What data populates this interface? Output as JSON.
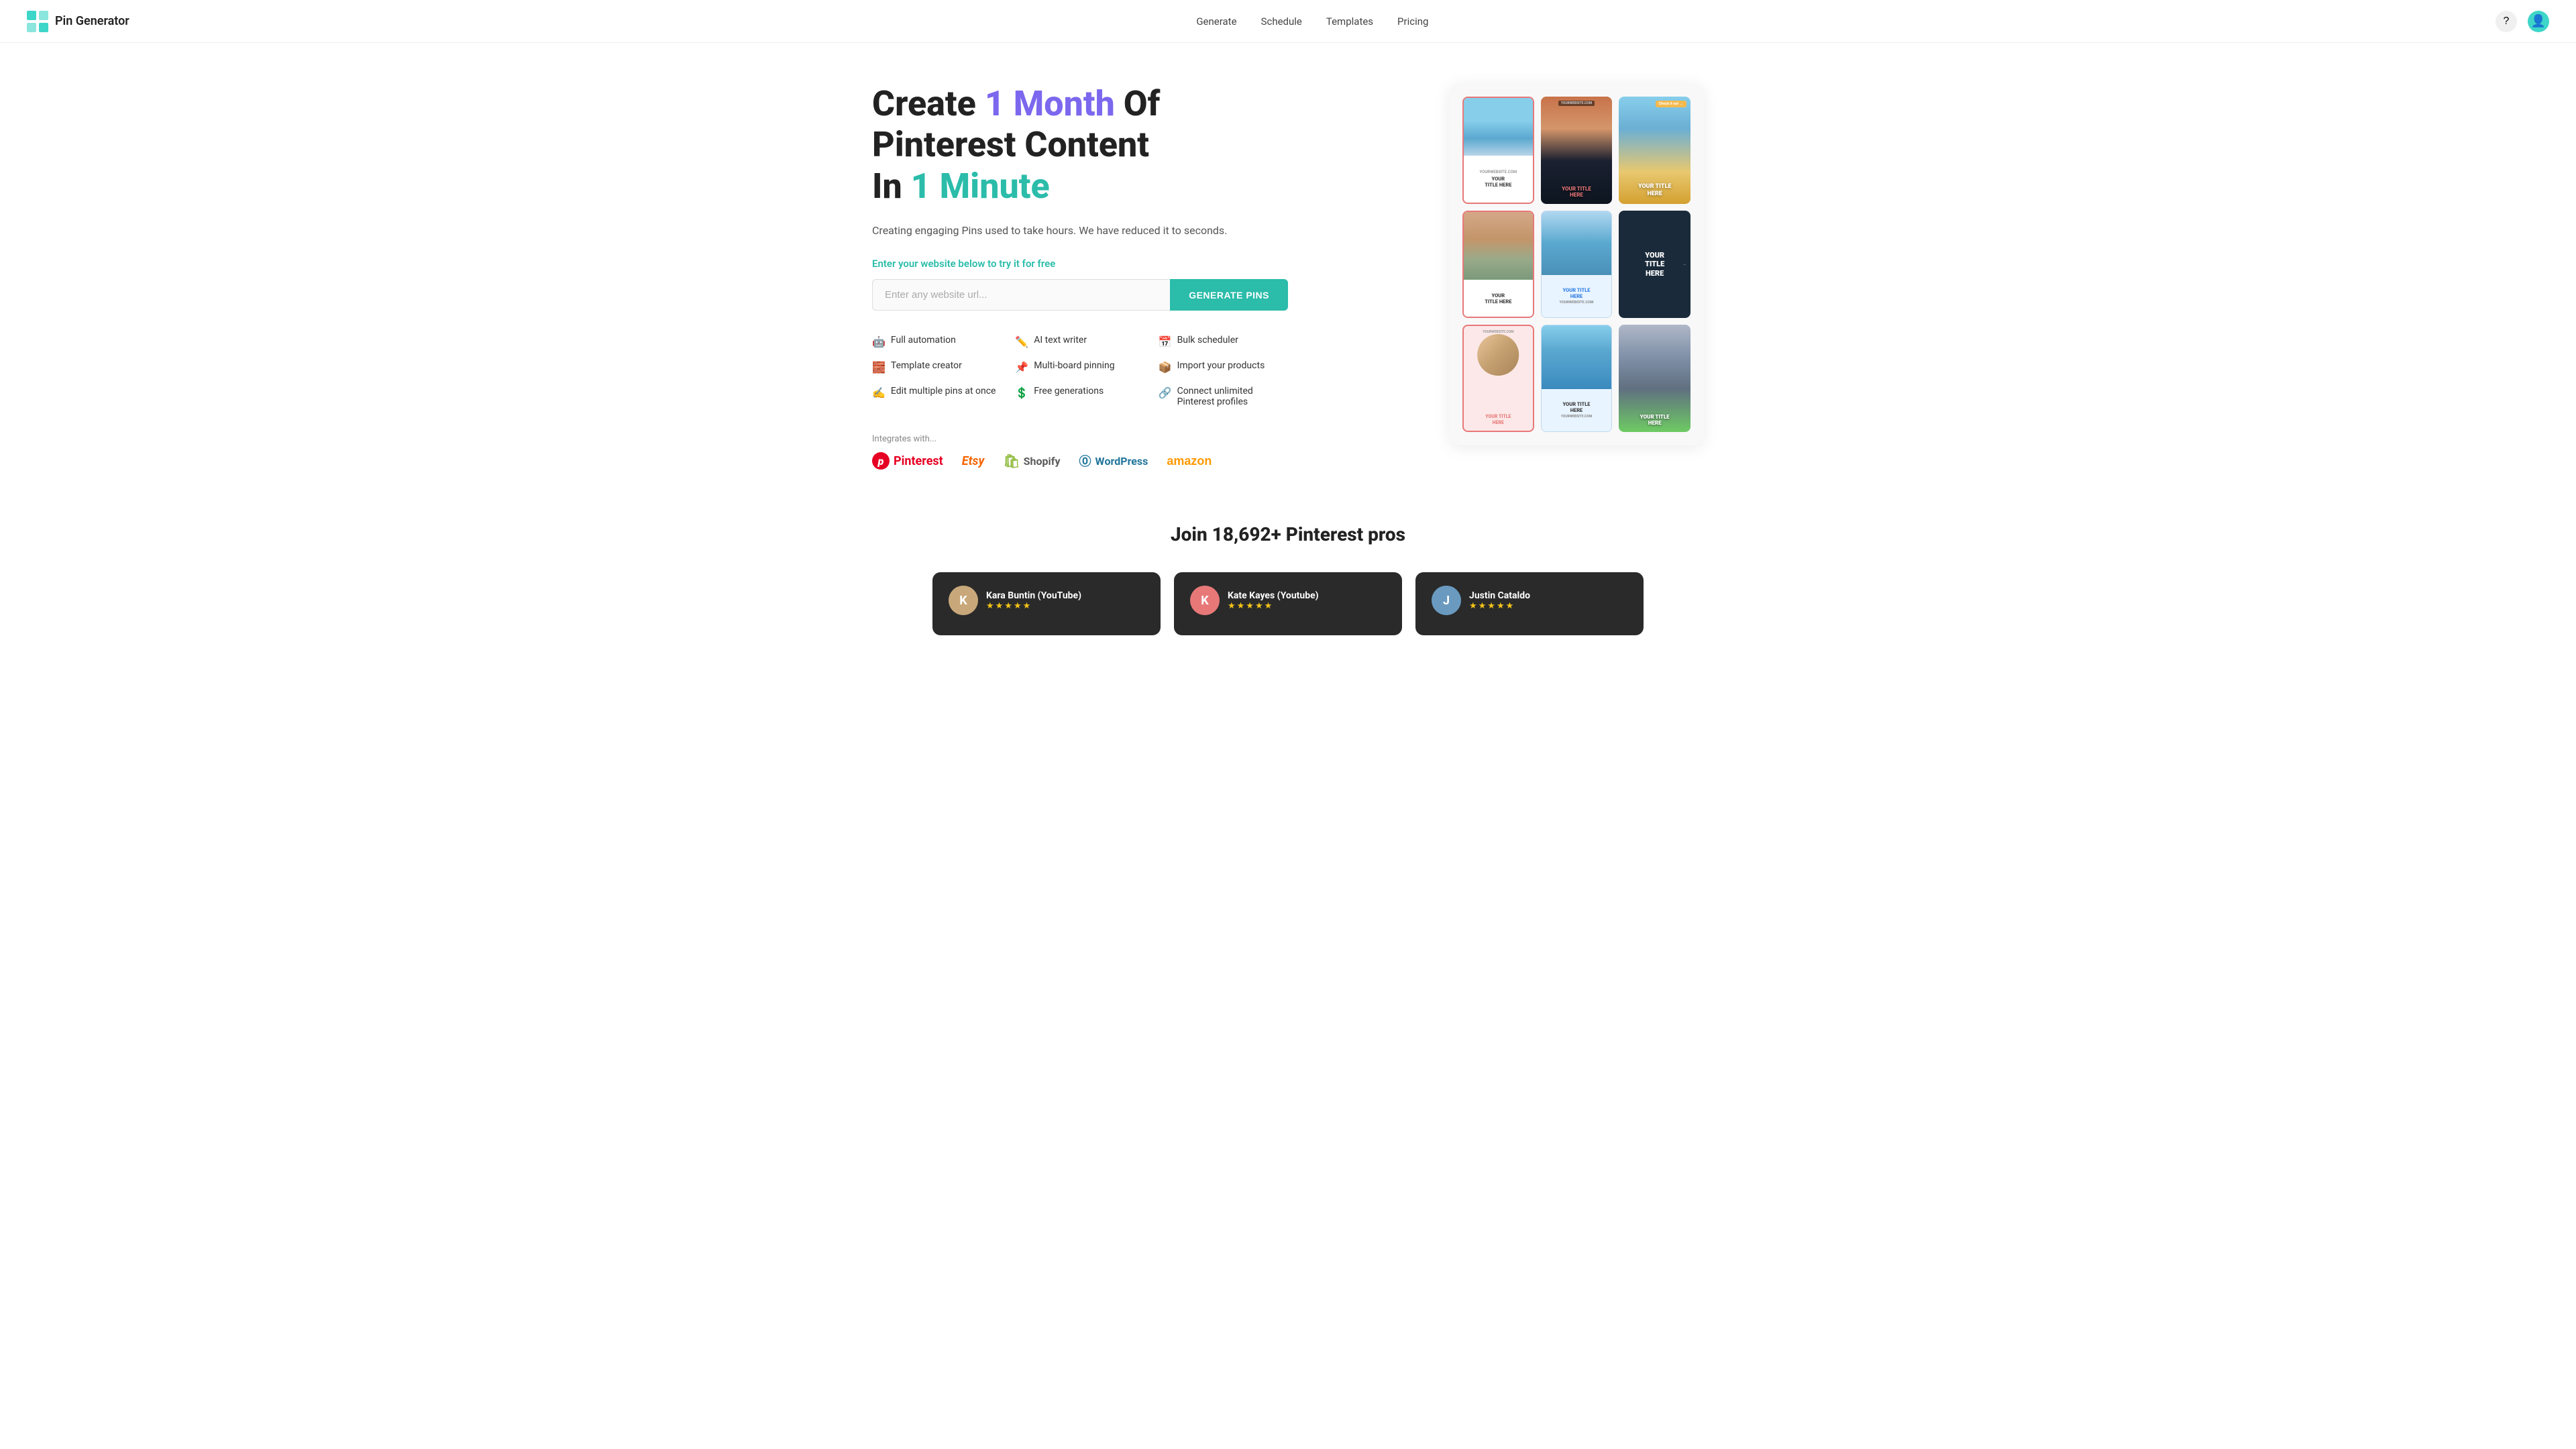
{
  "nav": {
    "logo_text": "Pin Generator",
    "links": [
      {
        "label": "Generate",
        "id": "generate"
      },
      {
        "label": "Schedule",
        "id": "schedule"
      },
      {
        "label": "Templates",
        "id": "templates"
      },
      {
        "label": "Pricing",
        "id": "pricing"
      }
    ]
  },
  "hero": {
    "title_part1": "Create ",
    "title_accent1": "1 Month",
    "title_part2": " Of",
    "title_line2": "Pinterest Content",
    "title_line3_pre": "In ",
    "title_accent2": "1 Minute",
    "subtitle": "Creating engaging Pins used to take hours. We have reduced it to seconds.",
    "cta_label": "Enter your website below to try it for free",
    "input_placeholder": "Enter any website url...",
    "button_label": "GENERATE PINS",
    "features": [
      {
        "icon": "🤖",
        "label": "Full automation"
      },
      {
        "icon": "✏️",
        "label": "AI text writer"
      },
      {
        "icon": "📅",
        "label": "Bulk scheduler"
      },
      {
        "icon": "🧱",
        "label": "Template creator"
      },
      {
        "icon": "📌",
        "label": "Multi-board pinning"
      },
      {
        "icon": "📦",
        "label": "Import your products"
      },
      {
        "icon": "✍️",
        "label": "Edit multiple pins at once"
      },
      {
        "icon": "💲",
        "label": "Free generations"
      },
      {
        "icon": "🔗",
        "label": "Connect unlimited Pinterest profiles"
      }
    ],
    "integrations_label": "Integrates with...",
    "integrations": [
      {
        "id": "pinterest",
        "label": "Pinterest"
      },
      {
        "id": "etsy",
        "label": "Etsy"
      },
      {
        "id": "shopify",
        "label": "Shopify"
      },
      {
        "id": "wordpress",
        "label": "WordPress"
      },
      {
        "id": "amazon",
        "label": "amazon"
      }
    ]
  },
  "pin_grid": {
    "cards": [
      {
        "id": "pin-1",
        "label": "YOUR\nTITLE HERE",
        "website": "YOURWEBSITE.COM",
        "bg": "white-border"
      },
      {
        "id": "pin-2",
        "label": "YOUR TITLE HERE",
        "website": "YOURWEBSITE.COM",
        "bg": "dark-photo"
      },
      {
        "id": "pin-3",
        "label": "YOUR TITLE\nHERE",
        "website": "Check it out →",
        "bg": "yellow"
      },
      {
        "id": "pin-4",
        "label": "YOUR\nTITLE HERE",
        "website": "",
        "bg": "pink-border"
      },
      {
        "id": "pin-5",
        "label": "YOUR TITLE\nHERE",
        "website": "YOURWEBSITE.COM",
        "bg": "light-ocean"
      },
      {
        "id": "pin-6",
        "label": "YOUR\nTITLE\nHERE",
        "website": "",
        "bg": "dark"
      },
      {
        "id": "pin-7",
        "label": "YOUR TITLE\nHERE",
        "website": "YOURWEBSITE.COM",
        "bg": "pink-border-2"
      },
      {
        "id": "pin-8",
        "label": "YOUR TITLE\nHERE",
        "website": "YOURWEBSITE.COM",
        "bg": "light-blue"
      },
      {
        "id": "pin-9",
        "label": "YOUR TITLE\nHERE",
        "website": "",
        "bg": "green"
      }
    ]
  },
  "join": {
    "title": "Join 18,692+ Pinterest pros"
  },
  "testimonials": [
    {
      "name": "Kara Buntin (YouTube)",
      "stars": "★★★★★",
      "avatar_color": "#c8a87a",
      "avatar_letter": "K"
    },
    {
      "name": "Kate Kayes (Youtube)",
      "stars": "★★★★★",
      "avatar_color": "#e87878",
      "avatar_letter": "K"
    },
    {
      "name": "Justin Cataldo",
      "stars": "★★★★★",
      "avatar_color": "#6a9abf",
      "avatar_letter": "J"
    }
  ]
}
